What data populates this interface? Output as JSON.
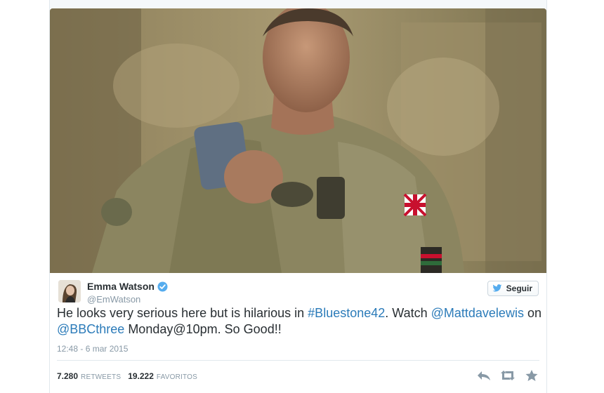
{
  "tweet": {
    "display_name": "Emma Watson",
    "screen_name": "@EmWatson",
    "text_parts": [
      {
        "text": "He looks very serious here but is hilarious in ",
        "link": false
      },
      {
        "text": "#Bluestone42",
        "link": true
      },
      {
        "text": ". Watch ",
        "link": false
      },
      {
        "text": "@Mattdavelewis",
        "link": true
      },
      {
        "text": " on ",
        "link": false
      },
      {
        "text": "@BBCthree",
        "link": true
      },
      {
        "text": " Monday@10pm. So Good!!",
        "link": false
      }
    ],
    "timestamp": "12:48 - 6 mar 2015",
    "follow_label": "Seguir",
    "retweets_count": "7.280",
    "retweets_label": "RETWEETS",
    "favorites_count": "19.222",
    "favorites_label": "FAVORITOS"
  },
  "colors": {
    "link": "#2b7bb9",
    "muted": "#8899a6",
    "verified": "#55acee",
    "bird": "#55acee"
  },
  "icons": [
    "verified-badge-icon",
    "twitter-bird-icon",
    "reply-icon",
    "retweet-icon",
    "favorite-star-icon"
  ]
}
